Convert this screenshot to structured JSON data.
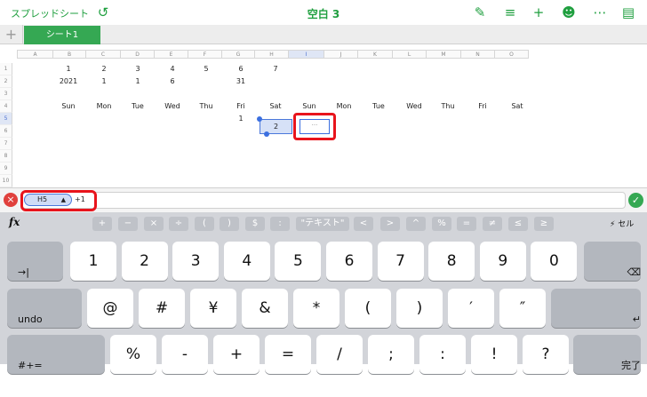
{
  "toolbar": {
    "back_label": "スプレッドシート",
    "title": "空白 3",
    "icons": [
      "undo-icon",
      "paintbrush-icon",
      "format-icon",
      "plus-icon",
      "collaborate-icon",
      "more-icon",
      "document-icon"
    ]
  },
  "tabs": {
    "add_label": "+",
    "sheet_label": "シート1"
  },
  "grid": {
    "columns": [
      "A",
      "B",
      "C",
      "D",
      "E",
      "F",
      "G",
      "H",
      "I",
      "J",
      "K",
      "L",
      "M",
      "N",
      "O"
    ],
    "selected_column": "I",
    "rows": [
      "1",
      "2",
      "3",
      "4",
      "5",
      "6",
      "7",
      "8",
      "9",
      "10"
    ],
    "selected_row": "5",
    "row1": [
      "1",
      "2",
      "3",
      "4",
      "5",
      "6",
      "7"
    ],
    "row2": [
      "2021",
      "1",
      "1",
      "6",
      "",
      "31"
    ],
    "row4": [
      "Sun",
      "Mon",
      "Tue",
      "Wed",
      "Thu",
      "Fri",
      "Sat",
      "Sun",
      "Mon",
      "Tue",
      "Wed",
      "Thu",
      "Fri",
      "Sat"
    ],
    "row5": [
      "1",
      "2"
    ],
    "active_cell_text": "···"
  },
  "formula": {
    "ref": "H5",
    "ref_arrow": "▲",
    "extra": "+1",
    "cancel_symbol": "×",
    "ok_symbol": "✓"
  },
  "keyboard": {
    "fx_label": "fx",
    "cell_label": "セル",
    "fx_keys": [
      "+",
      "−",
      "×",
      "÷",
      "(",
      ")",
      "$",
      ":",
      "\"テキスト\"",
      "<",
      ">",
      "^",
      "%",
      "=",
      "≠",
      "≤",
      "≥"
    ],
    "row1": [
      "1",
      "2",
      "3",
      "4",
      "5",
      "6",
      "7",
      "8",
      "9",
      "0"
    ],
    "row2": [
      "@",
      "#",
      "¥",
      "&",
      "*",
      "(",
      ")",
      "′",
      "″"
    ],
    "row3": [
      "%",
      "-",
      "+",
      "=",
      "/",
      ";",
      ":",
      "!",
      "?"
    ],
    "tab_label": "→|",
    "undo_label": "undo",
    "backspace_label": "⌫",
    "return_label": "↵",
    "shift_label": "#+=",
    "done_label": "完了"
  },
  "colors": {
    "accent": "#1f9f3f",
    "selection": "#4a78db",
    "highlight": "#e8141c"
  }
}
